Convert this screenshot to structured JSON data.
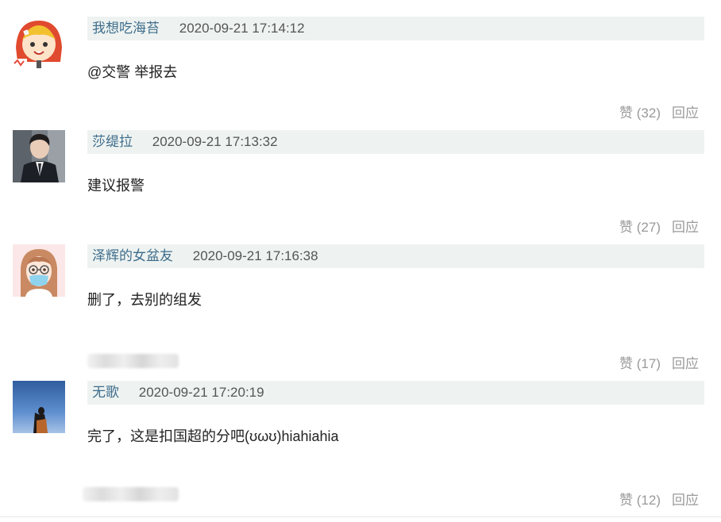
{
  "comments": [
    {
      "username": "我想吃海苔",
      "time": "2020-09-21 17:14:12",
      "content": "@交警 举报去",
      "likes": "赞 (32)",
      "reply": "回应",
      "avatar_icon": "cartoon-girl-avatar"
    },
    {
      "username": "莎缇拉",
      "time": "2020-09-21 17:13:32",
      "content": "建议报警",
      "likes": "赞 (27)",
      "reply": "回应",
      "avatar_icon": "man-in-suit-avatar"
    },
    {
      "username": "泽辉的女盆友",
      "time": "2020-09-21 17:16:38",
      "content": "删了，去别的组发",
      "likes": "赞 (17)",
      "reply": "回应",
      "avatar_icon": "girl-with-mask-avatar"
    },
    {
      "username": "无歌",
      "time": "2020-09-21 17:20:19",
      "content": "完了，这是扣国超的分吧(ʊωʊ)hiahiahia",
      "likes": "赞 (12)",
      "reply": "回应",
      "avatar_icon": "silhouette-blue-sky-avatar"
    }
  ],
  "colors": {
    "meta_bg": "#eef3f1",
    "username": "#3f6d8c",
    "action_gray": "#9a9a9a"
  }
}
